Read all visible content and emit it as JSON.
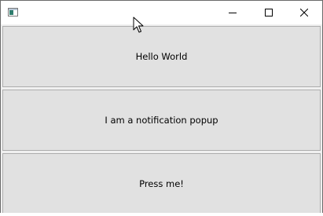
{
  "window": {
    "title": "",
    "icon": "app-window-icon",
    "controls": {
      "minimize_icon": "minimize-icon",
      "maximize_icon": "maximize-icon",
      "close_icon": "close-icon"
    }
  },
  "buttons": [
    {
      "label": "Hello World"
    },
    {
      "label": "I am a notification popup"
    },
    {
      "label": "Press me!"
    }
  ],
  "colors": {
    "window_bg": "#f0f0f0",
    "button_face": "#e1e1e1",
    "button_border": "#adadad",
    "titlebar": "#ffffff"
  }
}
